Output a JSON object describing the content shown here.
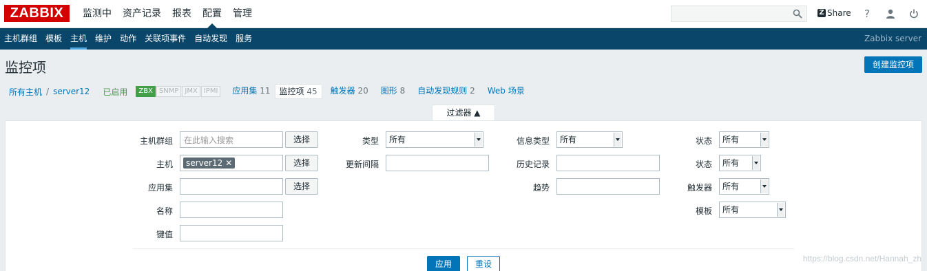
{
  "logo": "ZABBIX",
  "top_nav": [
    "监测中",
    "资产记录",
    "报表",
    "配置",
    "管理"
  ],
  "top_nav_active": "配置",
  "header": {
    "share_label": "Share",
    "help": "?",
    "user": "👤",
    "power": "⏻"
  },
  "sub_nav": [
    "主机群组",
    "模板",
    "主机",
    "维护",
    "动作",
    "关联项事件",
    "自动发现",
    "服务"
  ],
  "sub_nav_active": "主机",
  "server_name": "Zabbix server",
  "page_title": "监控项",
  "create_button": "创建监控项",
  "breadcrumb": {
    "all_hosts": "所有主机",
    "separator": "/",
    "host": "server12",
    "status": "已启用",
    "availability": [
      "ZBX",
      "SNMP",
      "JMX",
      "IPMI"
    ],
    "tabs": [
      {
        "label": "应用集",
        "count": "11"
      },
      {
        "label": "监控项",
        "count": "45"
      },
      {
        "label": "触发器",
        "count": "20"
      },
      {
        "label": "图形",
        "count": "8"
      },
      {
        "label": "自动发现规则",
        "count": "2"
      },
      {
        "label": "Web 场景",
        "count": ""
      }
    ]
  },
  "filter": {
    "tab_label": "过滤器 ▲",
    "host_group_label": "主机群组",
    "host_group_placeholder": "在此输入搜索",
    "host_label": "主机",
    "host_chip": "server12",
    "application_label": "应用集",
    "name_label": "名称",
    "key_label": "键值",
    "select_button": "选择",
    "type_label": "类型",
    "type_value": "所有",
    "update_interval_label": "更新间隔",
    "info_type_label": "信息类型",
    "info_type_value": "所有",
    "history_label": "历史记录",
    "trends_label": "趋势",
    "state_label": "状态",
    "state_value": "所有",
    "status_label": "状态",
    "status_value": "所有",
    "triggers_label": "触发器",
    "triggers_value": "所有",
    "template_label": "模板",
    "template_value": "所有",
    "apply_button": "应用",
    "reset_button": "重设"
  },
  "watermark": "https://blog.csdn.net/Hannah_zh"
}
